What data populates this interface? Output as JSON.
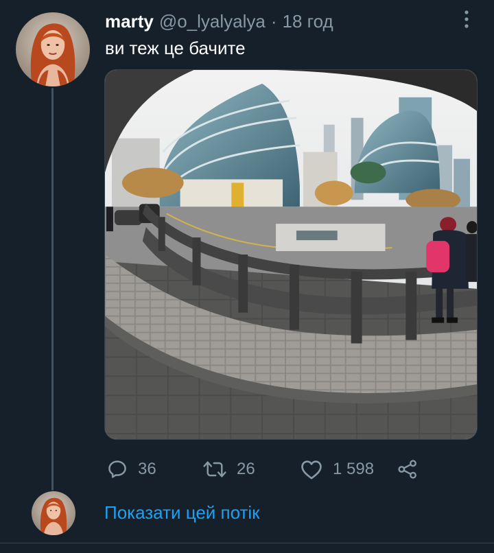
{
  "tweet": {
    "author": {
      "display_name": "marty",
      "handle": "@o_lyalyalya",
      "avatar": "profile-photo"
    },
    "separator": "·",
    "time": "18 год",
    "text": "ви теж це бачите",
    "media": "fisheye-city-street-photo",
    "more_icon": "more-vertical-icon",
    "actions": {
      "reply": {
        "icon": "reply-icon",
        "count": "36"
      },
      "retweet": {
        "icon": "retweet-icon",
        "count": "26"
      },
      "like": {
        "icon": "heart-icon",
        "count": "1 598"
      },
      "share": {
        "icon": "share-icon"
      }
    }
  },
  "thread": {
    "show_thread_label": "Показати цей потік",
    "avatar": "profile-photo"
  },
  "colors": {
    "background": "#15202b",
    "text_primary": "#ffffff",
    "text_secondary": "#8899a6",
    "accent": "#1da1f2",
    "thread_line": "#3d5466"
  }
}
